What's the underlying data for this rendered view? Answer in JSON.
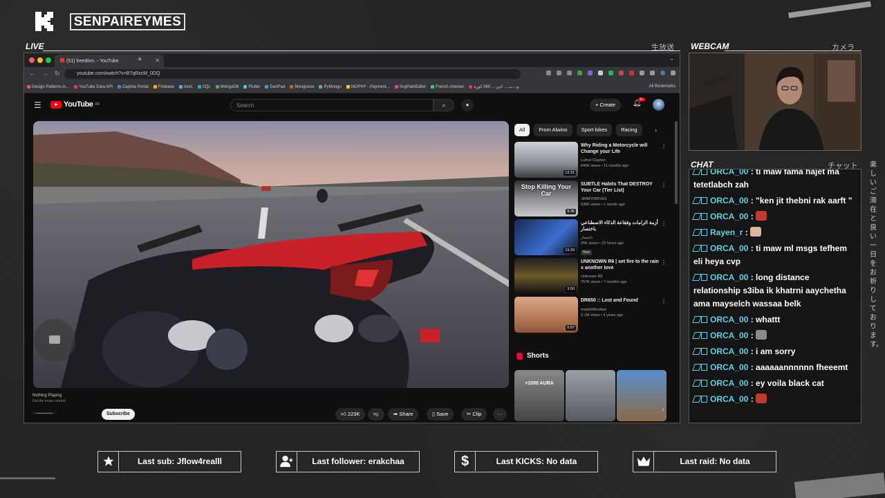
{
  "header": {
    "channel_name": "SENPAIREYMES"
  },
  "panels": {
    "live_label": "LIVE",
    "live_jp": "生放送",
    "webcam_label": "WEBCAM",
    "webcam_jp": "カメラ",
    "chat_label": "CHAT",
    "chat_jp": "チャット",
    "side_jp": "楽しいご滞在と良い一日をお祈りしております。"
  },
  "browser": {
    "tab_title": "(51) freedom. - YouTube",
    "url": "youtube.com/watch?v=B7qRzcM_0DQ",
    "bookmarks": [
      "Design Patterns in...",
      "YouTube Data API",
      "Captive Portal",
      "Firebase",
      "Ionic",
      "SQL",
      "MongoDB",
      "Flutter",
      "DartPad",
      "Mongoose",
      "PyMongo",
      "MOPHY - Payment...",
      "SvgPathEditor",
      "French checker",
      "و... ب ... لاين ... 360 كورة"
    ],
    "all_bookmarks": "All Bookmarks"
  },
  "youtube": {
    "logo": "YouTube",
    "region": "FR",
    "search_placeholder": "Search",
    "create_label": "Create",
    "notif_count": "9+",
    "chips": [
      "All",
      "From Alwino",
      "Sport bikes",
      "Racing"
    ],
    "now_playing": "Nothing Playing",
    "now_playing_sub": "Get the music started",
    "subscribe": "Subscribe",
    "actions": {
      "likes": "223K",
      "share": "Share",
      "save": "Save",
      "clip": "Clip",
      "more": "···"
    },
    "recommendations": [
      {
        "title": "Why Riding a Motorcycle will Change your Life",
        "channel": "Luther Clayton",
        "meta": "645K views • 11 months ago",
        "duration": "13:31"
      },
      {
        "title": "SUBTLE Habits That DESTROY Your Car (Tier List)",
        "channel": "JIMMYDRIVES",
        "meta": "636K views • 1 month ago",
        "duration": "9:36",
        "thumb_text": "Stop Killing Your Car"
      },
      {
        "title": "أزمة الزامات وفقاعة الذكاء الاصطناعي باختصار",
        "channel": "باختصار",
        "meta": "25K views • 22 hours ago",
        "duration": "13:29",
        "badge": "New"
      },
      {
        "title": "UNKNOWN R6 | set fire to the rain x another love",
        "channel": "Unknown R6",
        "meta": "767K views • 7 months ago",
        "duration": "3:50"
      },
      {
        "title": "DR650 :: Lost and Found",
        "channel": "modshiftmotion",
        "meta": "2.1M views • 4 years ago",
        "duration": "5:57"
      }
    ],
    "shorts_label": "Shorts",
    "shorts_first_text": "+1000 AURA"
  },
  "chat": {
    "messages": [
      {
        "user": "ORCA_00",
        "text": ": ti maw fama hajet ma tetetlabch zah"
      },
      {
        "user": "ORCA_00",
        "text": ": \"ken jit thebni rak aarft \""
      },
      {
        "user": "ORCA_00",
        "text": ":",
        "emote": "red-demon"
      },
      {
        "user": "Rayen_r",
        "text": ":",
        "emote": "face"
      },
      {
        "user": "ORCA_00",
        "text": ": ti maw ml msgs tefhem eli heya cvp"
      },
      {
        "user": "ORCA_00",
        "text": ": long distance relationship s3iba ik khatrni aaychetha ama mayselch wassaa belk"
      },
      {
        "user": "ORCA_00",
        "text": ": whattt"
      },
      {
        "user": "ORCA_00",
        "text": ":",
        "emote": "cat"
      },
      {
        "user": "ORCA_00",
        "text": ": i am sorry"
      },
      {
        "user": "ORCA_00",
        "text": ": aaaaaannnnnn fheeemt"
      },
      {
        "user": "ORCA_00",
        "text": ": ey voila black cat"
      },
      {
        "user": "ORCA_00",
        "text": ":",
        "emote": "red-demon"
      }
    ]
  },
  "alerts": {
    "last_sub": "Last sub: Jflow4realll",
    "last_follower": "Last follower: erakchaa",
    "last_kicks": "Last KICKS: No data",
    "last_raid": "Last raid: No data"
  },
  "colors": {
    "accent_cyan": "#62d0e6",
    "youtube_red": "#ff0000",
    "overlay_bg": "#242424"
  }
}
